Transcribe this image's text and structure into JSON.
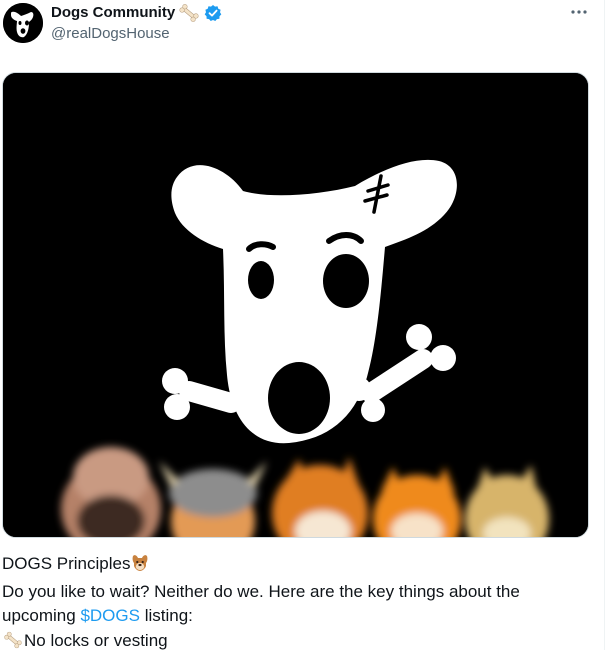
{
  "header": {
    "display_name": "Dogs Community",
    "handle": "@realDogsHouse",
    "more_label": "···"
  },
  "tweet": {
    "line1": "DOGS Principles",
    "line2": "Do you like to wait? Neither do we. Here are the key things about the",
    "line3_before": "upcoming ",
    "cashtag": "$DOGS",
    "line3_after": " listing:",
    "line4": "No locks or vesting"
  },
  "colors": {
    "link": "#1d9bf0",
    "verified": "#1d9bf0",
    "secondary_text": "#536471",
    "media_bg": "#000000"
  },
  "icons": {
    "avatar": "dog-logo-icon",
    "name_emoji": "bone-icon",
    "verified": "verified-badge-icon",
    "more": "more-options-icon",
    "principles_emoji": "dog-face-icon",
    "list_emoji": "bone-icon"
  }
}
